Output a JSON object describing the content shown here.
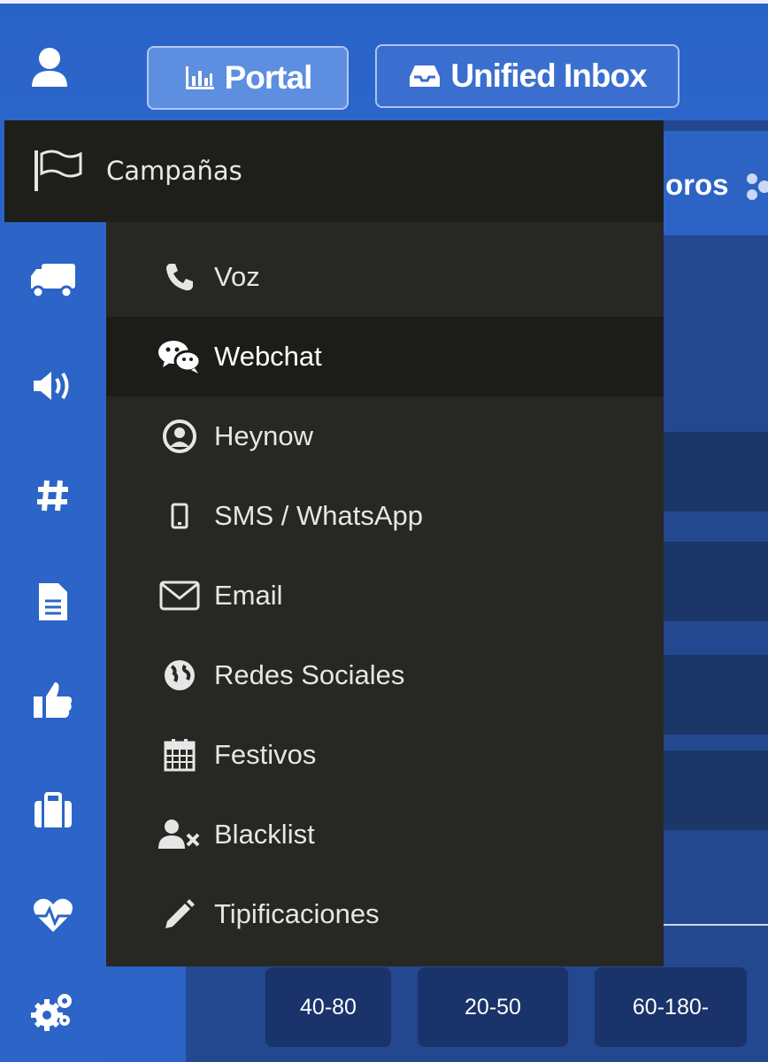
{
  "topbar": {
    "portal_label": "Portal",
    "inbox_label": "Unified Inbox"
  },
  "subnav": {
    "partial_text": "oros"
  },
  "menu": {
    "header_label": "Campañas",
    "items": [
      {
        "label": "Voz",
        "icon": "phone-icon"
      },
      {
        "label": "Webchat",
        "icon": "wechat-icon"
      },
      {
        "label": "Heynow",
        "icon": "user-circle-icon"
      },
      {
        "label": "SMS / WhatsApp",
        "icon": "mobile-icon"
      },
      {
        "label": "Email",
        "icon": "envelope-icon"
      },
      {
        "label": "Redes Sociales",
        "icon": "globe-icon"
      },
      {
        "label": "Festivos",
        "icon": "calendar-icon"
      },
      {
        "label": "Blacklist",
        "icon": "user-times-icon"
      },
      {
        "label": "Tipificaciones",
        "icon": "pencil-icon"
      }
    ],
    "active_item": "Webchat"
  },
  "sidebar_icons": [
    "user-icon",
    "truck-icon",
    "volume-icon",
    "hashtag-icon",
    "file-icon",
    "thumbs-up-icon",
    "briefcase-icon",
    "heartbeat-icon",
    "cogs-icon"
  ],
  "ranges": [
    "40-80",
    "20-50",
    "60-180-"
  ],
  "colors": {
    "brand_blue": "#2b63c6",
    "menu_bg": "#272723",
    "menu_header_bg": "#1e1e1b",
    "range_btn_bg": "#1a336a"
  }
}
